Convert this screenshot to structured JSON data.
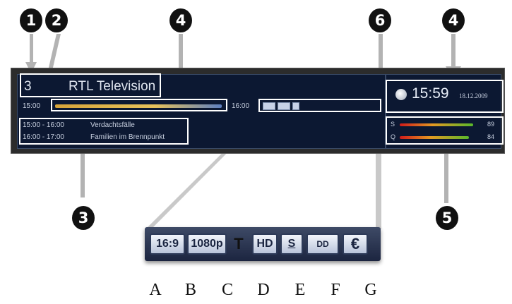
{
  "callouts": [
    "1",
    "2",
    "4",
    "6",
    "4",
    "3",
    "5"
  ],
  "channel": {
    "number": "3",
    "name": "RTL Television"
  },
  "progress": {
    "start": "15:00",
    "end": "16:00",
    "fraction": 0.97
  },
  "epg": [
    {
      "time": "15:00 - 16:00",
      "title": "Verdachtsfälle"
    },
    {
      "time": "16:00 - 17:00",
      "title": "Familien im Brennpunkt"
    }
  ],
  "clock": {
    "time": "15:59",
    "date": "18.12.2009"
  },
  "signal": [
    {
      "label": "S",
      "value": "89",
      "level": 0.89
    },
    {
      "label": "Q",
      "value": "84",
      "level": 0.84
    }
  ],
  "status_icons": [
    {
      "label": "16:9",
      "icon": "aspect-ratio-icon"
    },
    {
      "label": "1080p",
      "icon": "resolution-icon"
    },
    {
      "label": "T",
      "icon": "teletext-icon"
    },
    {
      "label": "HD",
      "icon": "hd-icon"
    },
    {
      "label": "S",
      "icon": "subtitle-icon"
    },
    {
      "label": "DD",
      "icon": "dolby-digital-icon"
    },
    {
      "label": "€",
      "icon": "pay-tv-icon"
    }
  ],
  "letters": [
    "A",
    "B",
    "C",
    "D",
    "E",
    "F",
    "G"
  ]
}
